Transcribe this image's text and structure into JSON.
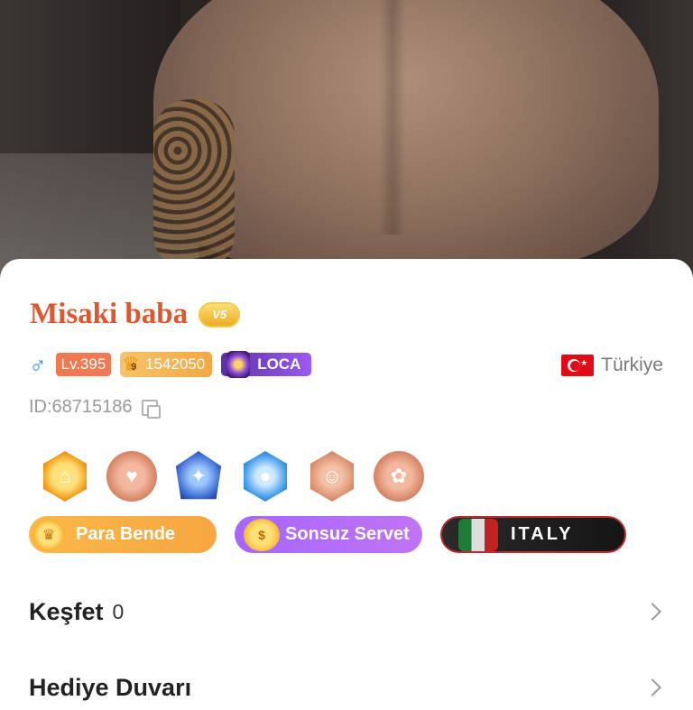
{
  "profile": {
    "name": "Misaki baba",
    "vip_badge": "V5",
    "gender_symbol": "♂",
    "level": "Lv.395",
    "wealth_rank": "9",
    "wealth_value": "1542050",
    "family_tag": "LOCA",
    "country": "Türkiye",
    "id_text": "ID:68715186"
  },
  "badges": [
    {
      "icon": "house-medal-icon"
    },
    {
      "icon": "heart-hand-medal-icon"
    },
    {
      "icon": "blue-wing-medal-icon"
    },
    {
      "icon": "microphone-medal-icon"
    },
    {
      "icon": "friends-medal-icon"
    },
    {
      "icon": "gift-medal-icon"
    }
  ],
  "tags": {
    "para_bende": "Para Bende",
    "sonsuz_servet": "Sonsuz Servet",
    "italy": "ITALY"
  },
  "menu": {
    "kesfet_label": "Keşfet",
    "kesfet_count": "0",
    "hediye_label": "Hediye Duvarı"
  },
  "colors": {
    "name": "#e0562f",
    "gender": "#2f8de4",
    "level_badge": "#f07852"
  }
}
